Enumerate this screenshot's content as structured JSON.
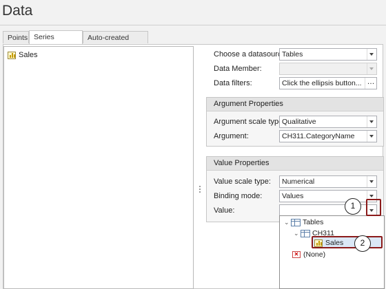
{
  "header": {
    "title": "Data"
  },
  "tabs": [
    {
      "label": "Points"
    },
    {
      "label": "Series Binding"
    },
    {
      "label": "Auto-created Series"
    }
  ],
  "series_list": {
    "items": [
      {
        "label": "Sales",
        "icon": "bar-chart-icon"
      }
    ]
  },
  "datasource": {
    "choose_label": "Choose a datasource:",
    "choose_value": "Tables",
    "member_label": "Data Member:",
    "member_value": "",
    "filters_label": "Data filters:",
    "filters_value": "Click the ellipsis button...",
    "ellipsis": "…"
  },
  "argument": {
    "group_title": "Argument Properties",
    "scale_label": "Argument scale type:",
    "scale_value": "Qualitative",
    "arg_label": "Argument:",
    "arg_value": "CH311.CategoryName"
  },
  "value": {
    "group_title": "Value Properties",
    "scale_label": "Value scale type:",
    "scale_value": "Numerical",
    "binding_label": "Binding mode:",
    "binding_value": "Values",
    "value_label": "Value:",
    "value_value": ""
  },
  "tree": {
    "root": "Tables",
    "child": "CH311",
    "leaf": "Sales",
    "none": "(None)"
  },
  "callouts": {
    "one": "1",
    "two": "2"
  },
  "colors": {
    "highlight": "#8b1a1a",
    "selection": "#dbe8f6"
  }
}
